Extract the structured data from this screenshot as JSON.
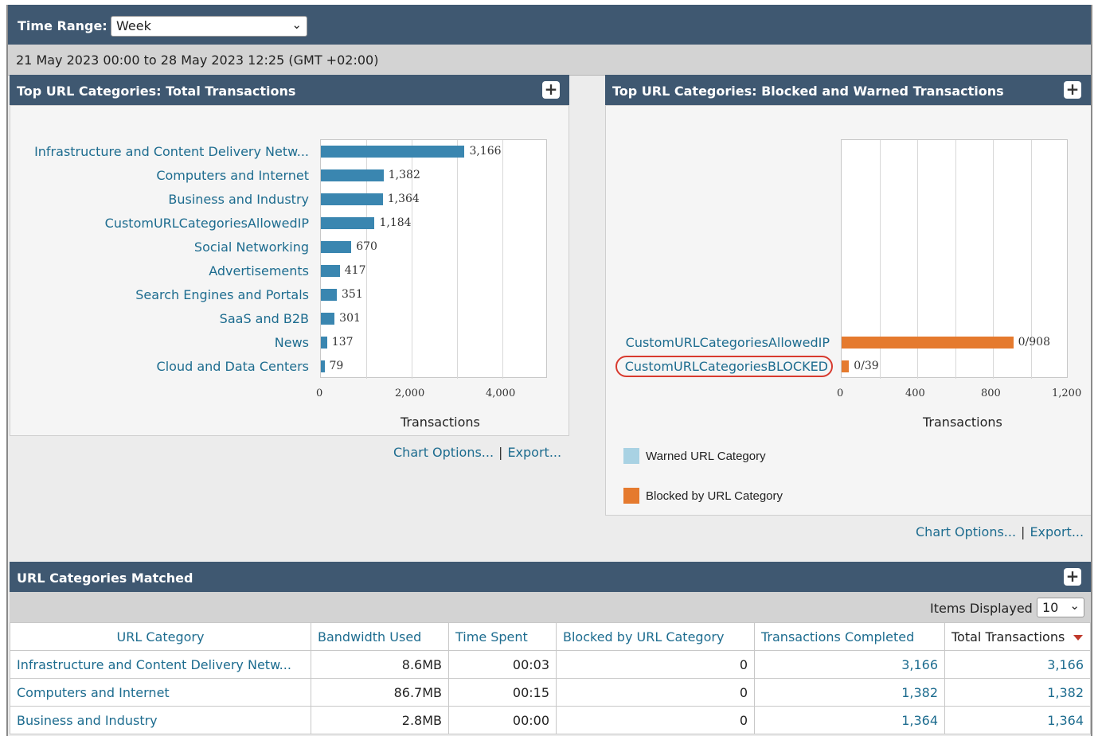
{
  "time_range": {
    "label": "Time Range:",
    "value": "Week"
  },
  "date_range": "21 May 2023 00:00 to 28 May 2023 12:25 (GMT +02:00)",
  "left_panel": {
    "title": "Top URL Categories: Total Transactions",
    "chart_options": "Chart Options...",
    "export": "Export..."
  },
  "right_panel": {
    "title": "Top URL Categories: Blocked and Warned Transactions",
    "chart_options": "Chart Options...",
    "export": "Export..."
  },
  "chart_data": [
    {
      "type": "bar",
      "orientation": "horizontal",
      "title": "Top URL Categories: Total Transactions",
      "xlabel": "Transactions",
      "xlim": [
        0,
        5000
      ],
      "xticks": [
        "0",
        "2,000",
        "4,000"
      ],
      "grid": true,
      "categories": [
        "Infrastructure and Content Delivery Netw...",
        "Computers and Internet",
        "Business and Industry",
        "CustomURLCategoriesAllowedIP",
        "Social Networking",
        "Advertisements",
        "Search Engines and Portals",
        "SaaS and B2B",
        "News",
        "Cloud and Data Centers"
      ],
      "values": [
        3166,
        1382,
        1364,
        1184,
        670,
        417,
        351,
        301,
        137,
        79
      ],
      "value_labels": [
        "3,166",
        "1,382",
        "1,364",
        "1,184",
        "670",
        "417",
        "351",
        "301",
        "137",
        "79"
      ],
      "color": "#3a86b0"
    },
    {
      "type": "bar",
      "orientation": "horizontal",
      "title": "Top URL Categories: Blocked and Warned Transactions",
      "xlabel": "Transactions",
      "xlim": [
        0,
        1200
      ],
      "xticks": [
        "0",
        "400",
        "800",
        "1,200"
      ],
      "grid": true,
      "categories": [
        "CustomURLCategoriesAllowedIP",
        "CustomURLCategoriesBLOCKED"
      ],
      "series": [
        {
          "name": "Warned URL Category",
          "values": [
            0,
            0
          ],
          "color": "#a9d2e3"
        },
        {
          "name": "Blocked by URL Category",
          "values": [
            908,
            39
          ],
          "color": "#e57a2e"
        }
      ],
      "value_labels": [
        "0/908",
        "0/39"
      ],
      "highlighted_category": "CustomURLCategoriesBLOCKED",
      "legend_position": "bottom"
    }
  ],
  "table": {
    "title": "URL Categories Matched",
    "items_label": "Items Displayed",
    "items_value": "10",
    "columns": [
      "URL Category",
      "Bandwidth Used",
      "Time Spent",
      "Blocked by URL Category",
      "Transactions Completed",
      "Total Transactions"
    ],
    "rows": [
      [
        "Infrastructure and Content Delivery Netw...",
        "8.6MB",
        "00:03",
        "0",
        "3,166",
        "3,166"
      ],
      [
        "Computers and Internet",
        "86.7MB",
        "00:15",
        "0",
        "1,382",
        "1,382"
      ],
      [
        "Business and Industry",
        "2.8MB",
        "00:00",
        "0",
        "1,364",
        "1,364"
      ]
    ]
  },
  "colors": {
    "header_bg": "#3f5871",
    "link": "#1d6c8f",
    "highlight_ring": "#d83a2e"
  },
  "icons": {
    "expand": "plus-icon",
    "sort": "sort-desc-icon",
    "dropdown": "chevron-down-icon"
  }
}
